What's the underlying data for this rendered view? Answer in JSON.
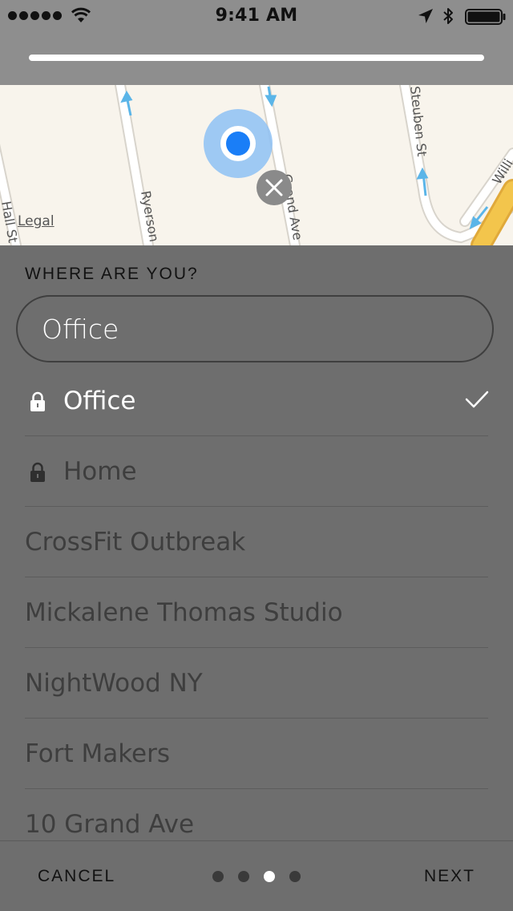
{
  "status_bar": {
    "time": "9:41 AM"
  },
  "progress": {
    "fraction": 1.0
  },
  "map": {
    "legal_label": "Legal",
    "streets": [
      "Hall St",
      "Ryerson",
      "Grand Ave",
      "Steuben St",
      "Willi"
    ],
    "user_location_color": "#1a7ef7"
  },
  "sheet": {
    "title": "WHERE ARE YOU?",
    "search": {
      "value": "Office",
      "placeholder": ""
    },
    "locations": [
      {
        "label": "Office",
        "locked": true,
        "selected": true,
        "lock_icon": "lock-icon",
        "check_icon": "checkmark-icon"
      },
      {
        "label": "Home",
        "locked": true,
        "selected": false,
        "lock_icon": "lock-icon"
      },
      {
        "label": "CrossFit Outbreak",
        "locked": false,
        "selected": false
      },
      {
        "label": "Mickalene Thomas Studio",
        "locked": false,
        "selected": false
      },
      {
        "label": "NightWood NY",
        "locked": false,
        "selected": false
      },
      {
        "label": "Fort Makers",
        "locked": false,
        "selected": false
      },
      {
        "label": "10 Grand Ave",
        "locked": false,
        "selected": false
      }
    ]
  },
  "footer": {
    "cancel_label": "CANCEL",
    "next_label": "NEXT",
    "page_indicator": {
      "count": 4,
      "current": 3
    }
  },
  "colors": {
    "overlay_gray": "#6e6e6e",
    "map_background": "#f8f4ec",
    "route_blue": "#5bb5e8",
    "highway_yellow": "#f3c54c"
  }
}
